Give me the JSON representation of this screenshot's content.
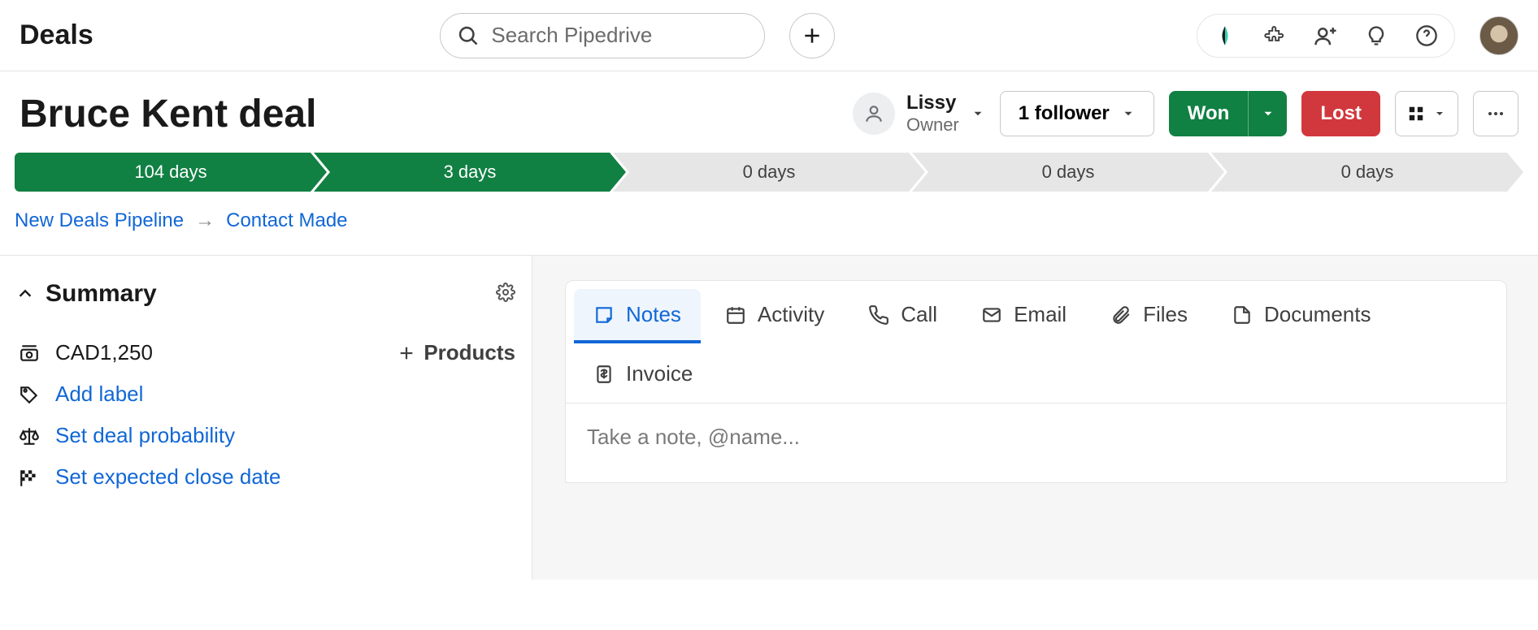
{
  "header": {
    "app_title": "Deals",
    "search_placeholder": "Search Pipedrive"
  },
  "deal": {
    "title": "Bruce Kent deal",
    "owner_name": "Lissy",
    "owner_role": "Owner",
    "followers_label": "1 follower",
    "won_label": "Won",
    "lost_label": "Lost"
  },
  "pipeline": {
    "stages": [
      {
        "label": "104 days",
        "done": true
      },
      {
        "label": "3 days",
        "done": true
      },
      {
        "label": "0 days",
        "done": false
      },
      {
        "label": "0 days",
        "done": false
      },
      {
        "label": "0 days",
        "done": false
      }
    ]
  },
  "breadcrumb": {
    "pipeline": "New Deals Pipeline",
    "stage": "Contact Made"
  },
  "summary": {
    "heading": "Summary",
    "value": "CAD1,250",
    "products_label": "Products",
    "add_label": "Add label",
    "set_probability": "Set deal probability",
    "set_close_date": "Set expected close date"
  },
  "tabs": {
    "items": [
      {
        "label": "Notes",
        "icon": "note"
      },
      {
        "label": "Activity",
        "icon": "calendar"
      },
      {
        "label": "Call",
        "icon": "phone"
      },
      {
        "label": "Email",
        "icon": "mail"
      },
      {
        "label": "Files",
        "icon": "clip"
      },
      {
        "label": "Documents",
        "icon": "doc"
      },
      {
        "label": "Invoice",
        "icon": "invoice"
      }
    ],
    "active_index": 0,
    "note_placeholder": "Take a note, @name..."
  }
}
